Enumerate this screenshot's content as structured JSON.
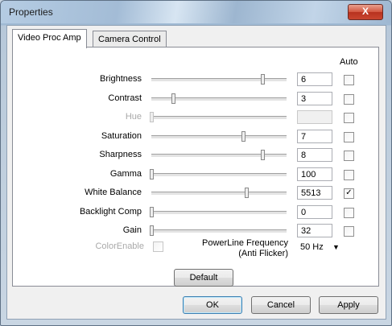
{
  "window": {
    "title": "Properties",
    "close_label": "X"
  },
  "tabs": [
    "Video Proc Amp",
    "Camera Control"
  ],
  "auto_header": "Auto",
  "rows": [
    {
      "label": "Brightness",
      "value": "6",
      "slider_fraction": 0.82,
      "enabled": true,
      "auto": false
    },
    {
      "label": "Contrast",
      "value": "3",
      "slider_fraction": 0.16,
      "enabled": true,
      "auto": false
    },
    {
      "label": "Hue",
      "value": "",
      "slider_fraction": 0.0,
      "enabled": false,
      "auto": false
    },
    {
      "label": "Saturation",
      "value": "7",
      "slider_fraction": 0.68,
      "enabled": true,
      "auto": false
    },
    {
      "label": "Sharpness",
      "value": "8",
      "slider_fraction": 0.82,
      "enabled": true,
      "auto": false
    },
    {
      "label": "Gamma",
      "value": "100",
      "slider_fraction": 0.0,
      "enabled": true,
      "auto": false
    },
    {
      "label": "White Balance",
      "value": "5513",
      "slider_fraction": 0.7,
      "enabled": true,
      "auto": true
    },
    {
      "label": "Backlight Comp",
      "value": "0",
      "slider_fraction": 0.0,
      "enabled": true,
      "auto": false
    },
    {
      "label": "Gain",
      "value": "32",
      "slider_fraction": 0.0,
      "enabled": true,
      "auto": false
    }
  ],
  "colorenable": {
    "label": "ColorEnable",
    "checked": false
  },
  "powerline": {
    "label_line1": "PowerLine Frequency",
    "label_line2": "(Anti Flicker)",
    "selected": "50 Hz",
    "arrow": "▼"
  },
  "buttons": {
    "default": "Default",
    "ok": "OK",
    "cancel": "Cancel",
    "apply": "Apply"
  },
  "check_mark": "✓"
}
